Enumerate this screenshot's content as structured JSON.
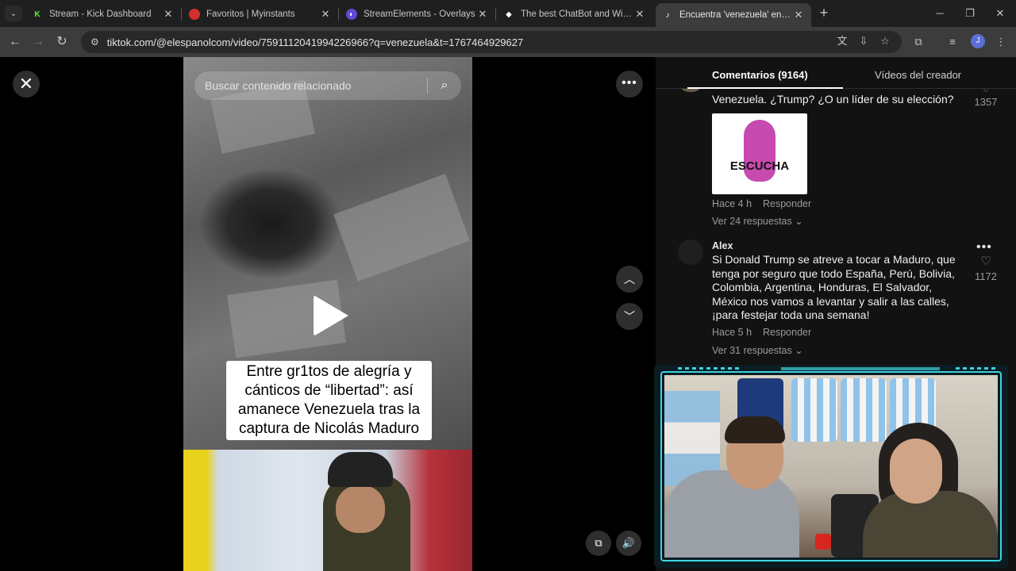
{
  "browser": {
    "tabs": [
      {
        "title": "Stream - Kick Dashboard",
        "icon": "kick-icon",
        "color": "#53fc18"
      },
      {
        "title": "Favoritos | Myinstants",
        "icon": "myinstants-icon",
        "color": "#d32f2f"
      },
      {
        "title": "StreamElements - Overlays",
        "icon": "streamelements-icon",
        "color": "#5b4bd5"
      },
      {
        "title": "The best ChatBot and Widgets f",
        "icon": "chatbot-icon",
        "color": "#ffffff"
      },
      {
        "title": "Encuentra 'venezuela' en TikTok",
        "icon": "tiktok-icon",
        "color": "#ffffff",
        "active": true
      }
    ],
    "url": "tiktok.com/@elespanolcom/video/7591112041994226966?q=venezuela&t=1767464929627",
    "profile_initial": "J"
  },
  "video": {
    "search_placeholder": "Buscar contenido relacionado",
    "caption": "Entre gr1tos de alegría y cánticos de “libertad”: así amanece Venezuela tras la captura de Nicolás Maduro"
  },
  "comments": {
    "tabs": {
      "comments": "Comentarios (9164)",
      "creator_videos": "Vídeos del creador"
    },
    "items": [
      {
        "text": "Venezuela. ¿Trump? ¿O un líder de su elección?",
        "sticker_text": "ESCUCHA",
        "time": "Hace 4 h",
        "reply": "Responder",
        "replies": "Ver 24 respuestas",
        "likes": "1357"
      },
      {
        "author": "Alex",
        "text": "Si Donald Trump se atreve a tocar a Maduro, que tenga por seguro que todo España, Perú, Bolivia, Colombia, Argentina, Honduras, El Salvador, México nos vamos a levantar y salir a las calles, ¡para festejar toda una semana!",
        "time": "Hace 5 h",
        "reply": "Responder",
        "replies": "Ver 31 respuestas",
        "likes": "1172"
      }
    ]
  },
  "colors": {
    "accent_cam_frame": "#3fd3e0",
    "panel_bg": "#121212",
    "browser_toolbar": "#3c3c3c"
  }
}
